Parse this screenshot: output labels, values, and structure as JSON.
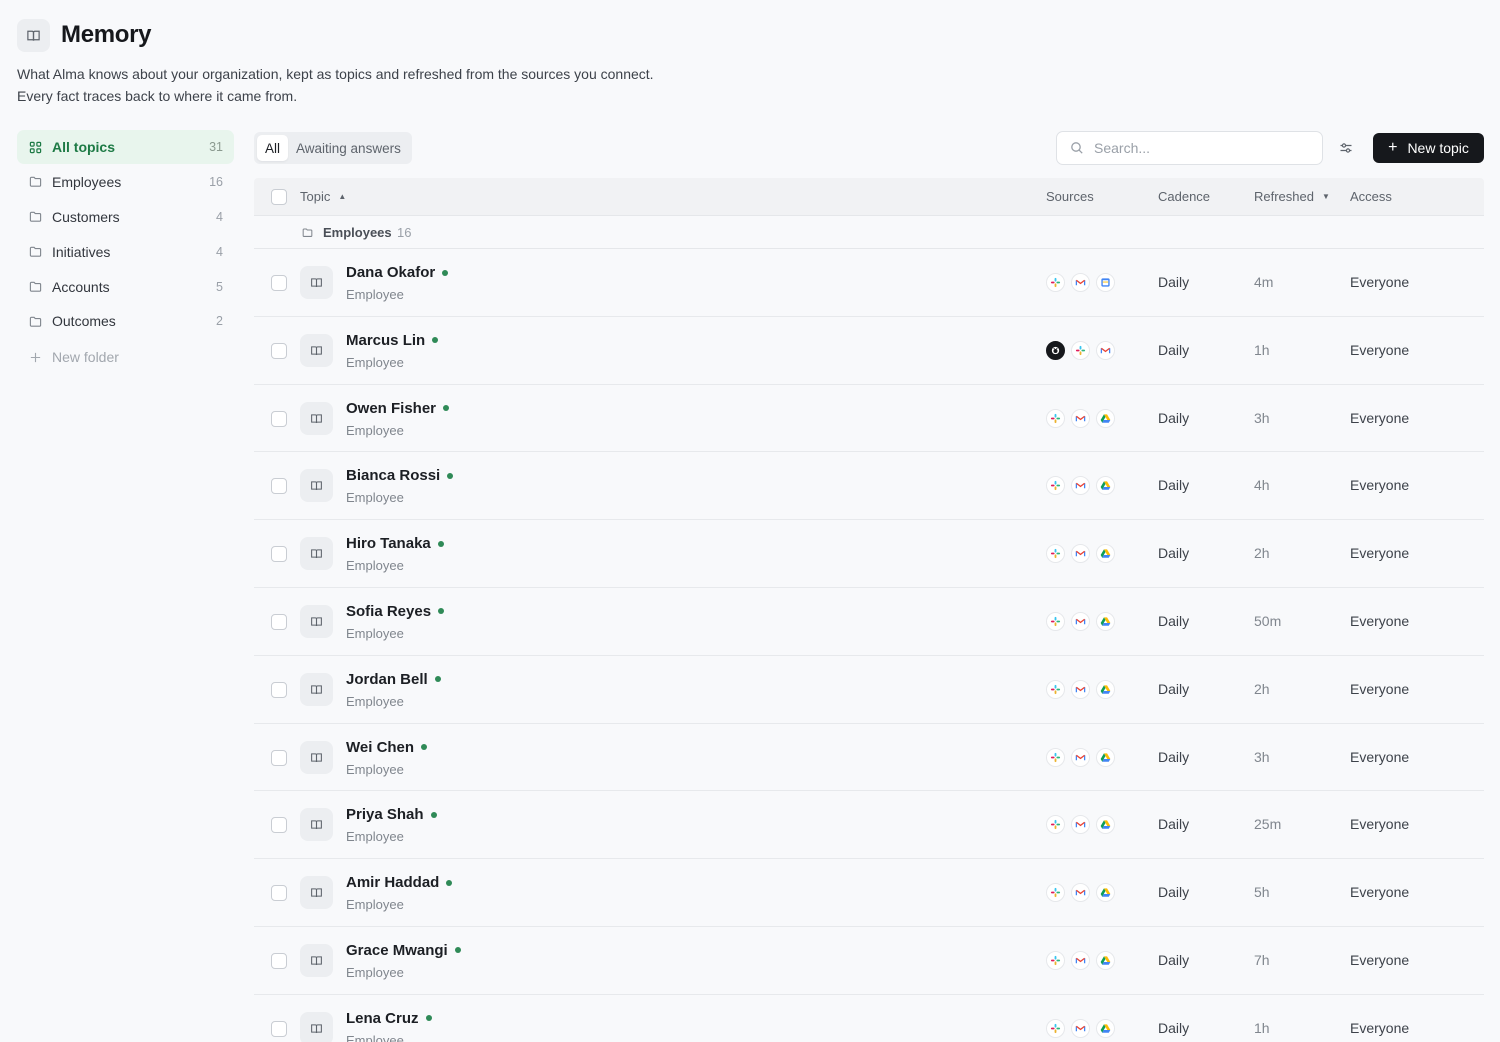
{
  "header": {
    "title": "Memory",
    "description": "What Alma knows about your organization, kept as topics and refreshed from the sources you connect. Every fact traces back to where it came from."
  },
  "sidebar": {
    "items": [
      {
        "label": "All topics",
        "count": "31",
        "icon": "grid-icon",
        "active": true
      },
      {
        "label": "Employees",
        "count": "16",
        "icon": "folder-icon"
      },
      {
        "label": "Customers",
        "count": "4",
        "icon": "folder-icon"
      },
      {
        "label": "Initiatives",
        "count": "4",
        "icon": "folder-icon"
      },
      {
        "label": "Accounts",
        "count": "5",
        "icon": "folder-icon"
      },
      {
        "label": "Outcomes",
        "count": "2",
        "icon": "folder-icon"
      }
    ],
    "new_folder_label": "New folder"
  },
  "toolbar": {
    "tabs": [
      {
        "label": "All",
        "active": true
      },
      {
        "label": "Awaiting answers"
      }
    ],
    "search_placeholder": "Search...",
    "new_topic_label": "New topic"
  },
  "table": {
    "columns": {
      "topic": "Topic",
      "sources": "Sources",
      "cadence": "Cadence",
      "refreshed": "Refreshed",
      "access": "Access"
    },
    "group": {
      "name": "Employees",
      "count": "16"
    },
    "rows": [
      {
        "name": "Dana Okafor",
        "type": "Employee",
        "sources": [
          "slack",
          "gmail",
          "calendar"
        ],
        "cadence": "Daily",
        "refreshed": "4m",
        "access": "Everyone"
      },
      {
        "name": "Marcus Lin",
        "type": "Employee",
        "sources": [
          "github",
          "slack",
          "gmail"
        ],
        "cadence": "Daily",
        "refreshed": "1h",
        "access": "Everyone"
      },
      {
        "name": "Owen Fisher",
        "type": "Employee",
        "sources": [
          "slack",
          "gmail",
          "drive"
        ],
        "cadence": "Daily",
        "refreshed": "3h",
        "access": "Everyone"
      },
      {
        "name": "Bianca Rossi",
        "type": "Employee",
        "sources": [
          "slack",
          "gmail",
          "drive"
        ],
        "cadence": "Daily",
        "refreshed": "4h",
        "access": "Everyone"
      },
      {
        "name": "Hiro Tanaka",
        "type": "Employee",
        "sources": [
          "slack",
          "gmail",
          "drive"
        ],
        "cadence": "Daily",
        "refreshed": "2h",
        "access": "Everyone"
      },
      {
        "name": "Sofia Reyes",
        "type": "Employee",
        "sources": [
          "slack",
          "gmail",
          "drive"
        ],
        "cadence": "Daily",
        "refreshed": "50m",
        "access": "Everyone"
      },
      {
        "name": "Jordan Bell",
        "type": "Employee",
        "sources": [
          "slack",
          "gmail",
          "drive"
        ],
        "cadence": "Daily",
        "refreshed": "2h",
        "access": "Everyone"
      },
      {
        "name": "Wei Chen",
        "type": "Employee",
        "sources": [
          "slack",
          "gmail",
          "drive"
        ],
        "cadence": "Daily",
        "refreshed": "3h",
        "access": "Everyone"
      },
      {
        "name": "Priya Shah",
        "type": "Employee",
        "sources": [
          "slack",
          "gmail",
          "drive"
        ],
        "cadence": "Daily",
        "refreshed": "25m",
        "access": "Everyone"
      },
      {
        "name": "Amir Haddad",
        "type": "Employee",
        "sources": [
          "slack",
          "gmail",
          "drive"
        ],
        "cadence": "Daily",
        "refreshed": "5h",
        "access": "Everyone"
      },
      {
        "name": "Grace Mwangi",
        "type": "Employee",
        "sources": [
          "slack",
          "gmail",
          "drive"
        ],
        "cadence": "Daily",
        "refreshed": "7h",
        "access": "Everyone"
      },
      {
        "name": "Lena Cruz",
        "type": "Employee",
        "sources": [
          "slack",
          "gmail",
          "drive"
        ],
        "cadence": "Daily",
        "refreshed": "1h",
        "access": "Everyone"
      }
    ]
  },
  "colors": {
    "accent": "#1d7a45",
    "active_bg": "#e8f5ed",
    "status_dot": "#2f8a57",
    "primary_button": "#16181c"
  }
}
